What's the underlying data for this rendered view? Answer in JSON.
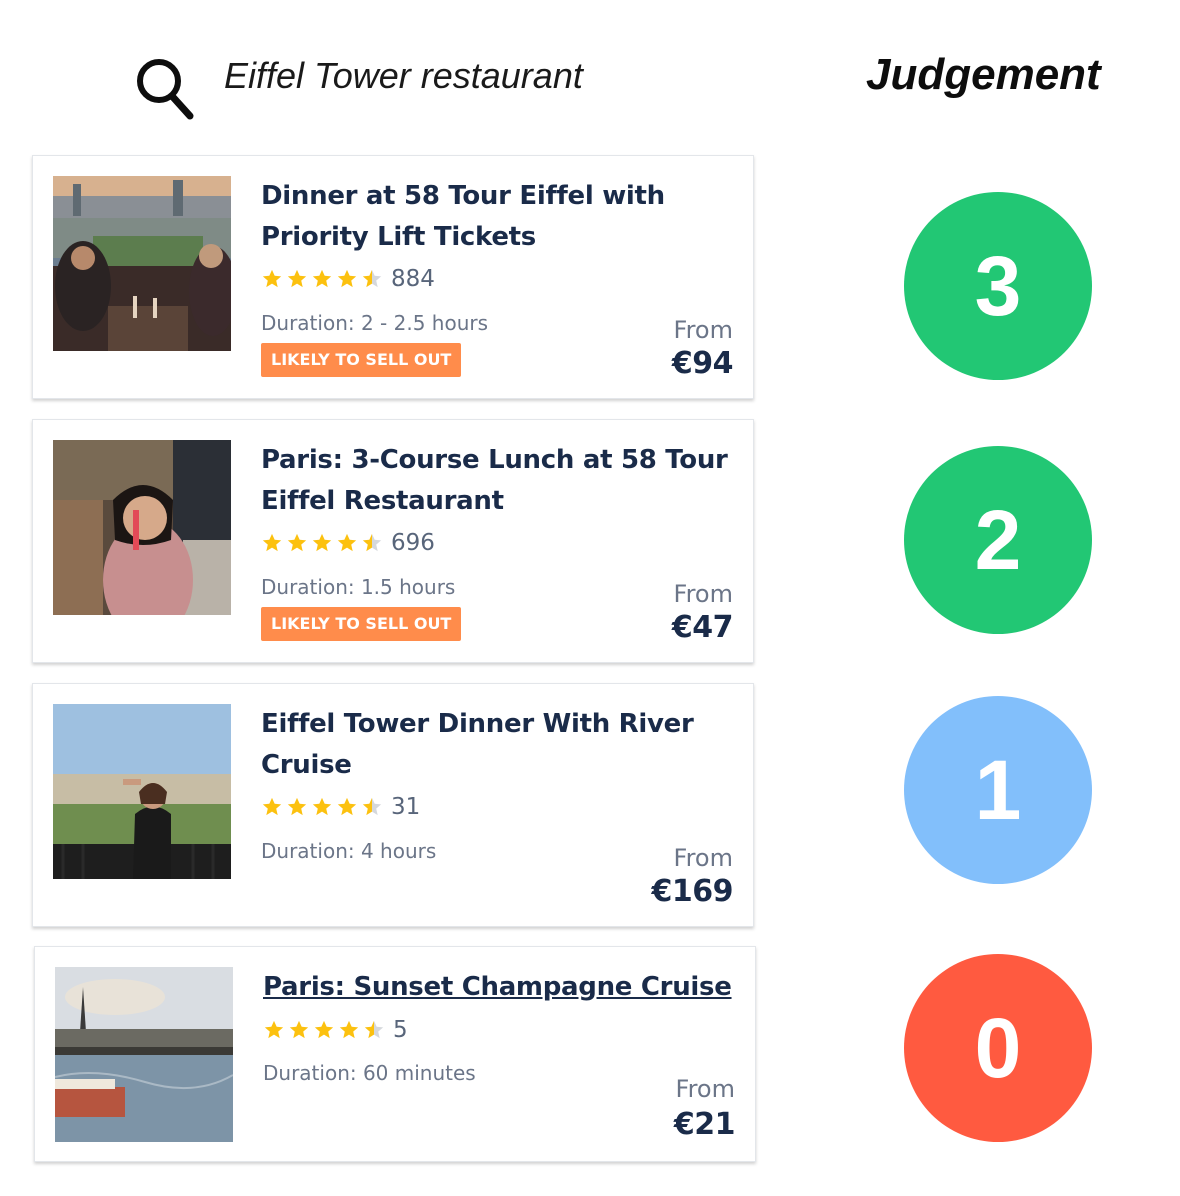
{
  "search": {
    "query": "Eiffel Tower restaurant",
    "icon": "search-icon"
  },
  "judgement": {
    "title": "Judgement"
  },
  "colors": {
    "star": "#fcc10f",
    "badge": "#ff8c4b",
    "score_3": "#22c774",
    "score_2": "#22c774",
    "score_1": "#82bffb",
    "score_0": "#ff5a40"
  },
  "results": [
    {
      "title": "Dinner at 58 Tour Eiffel with Priority Lift Tickets",
      "rating": 4.5,
      "review_count": "884",
      "duration": "Duration: 2 - 2.5 hours",
      "badge": "LIKELY TO SELL OUT",
      "from_label": "From",
      "price": "€94",
      "judgement": "3"
    },
    {
      "title": "Paris: 3-Course Lunch at 58 Tour Eiffel Restaurant",
      "rating": 4.5,
      "review_count": "696",
      "duration": "Duration: 1.5 hours",
      "badge": "LIKELY TO SELL OUT",
      "from_label": "From",
      "price": "€47",
      "judgement": "2"
    },
    {
      "title": "Eiffel Tower Dinner With River Cruise",
      "rating": 4.5,
      "review_count": "31",
      "duration": "Duration: 4 hours",
      "from_label": "From",
      "price": "€169",
      "judgement": "1"
    },
    {
      "title": "Paris: Sunset Champagne Cruise",
      "rating": 4.5,
      "review_count": "5",
      "duration": "Duration: 60 minutes",
      "from_label": "From",
      "price": "€21",
      "judgement": "0"
    }
  ]
}
